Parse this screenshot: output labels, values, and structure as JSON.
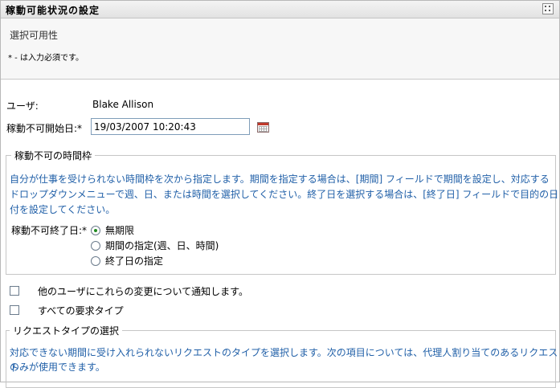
{
  "title": "稼動可能状況の設定",
  "subtitle": "選択可用性",
  "required_note": "* - は入力必須です。",
  "user": {
    "label": "ユーザ:",
    "value": "Blake Allison"
  },
  "start_date": {
    "label": "稼動不可開始日:*",
    "value": "19/03/2007 10:20:43"
  },
  "unavailable_section": {
    "legend": "稼動不可の時間枠",
    "info_lines": [
      "自分が仕事を受けられない時間枠を次から指定します。期間を指定する場合は、[期間] フィールドで期間を設定し、対応する",
      "ドロップダウンメニューで週、日、または時間を選択してください。終了日を選択する場合は、[終了日] フィールドで目的の日",
      "付を設定してください。"
    ],
    "end_label": "稼動不可終了日:*",
    "options": [
      {
        "label": "無期限",
        "selected": true
      },
      {
        "label": "期間の指定(週、日、時間)",
        "selected": false
      },
      {
        "label": "終了日の指定",
        "selected": false
      }
    ]
  },
  "notify_checkbox": {
    "label": "他のユーザにこれらの変更について通知します。",
    "checked": false
  },
  "all_requests_checkbox": {
    "label": "すべての要求タイプ",
    "checked": false
  },
  "request_section": {
    "legend": "リクエストタイプの選択",
    "info_lines": [
      "対応できない期間に受け入れられないリクエストのタイプを選択します。次の項目については、代理人割り当てのあるリクエスト",
      "のみが使用できます。"
    ]
  },
  "colors": {
    "info_text": "#2160a8",
    "radio_selected": "#1f8a1f"
  }
}
